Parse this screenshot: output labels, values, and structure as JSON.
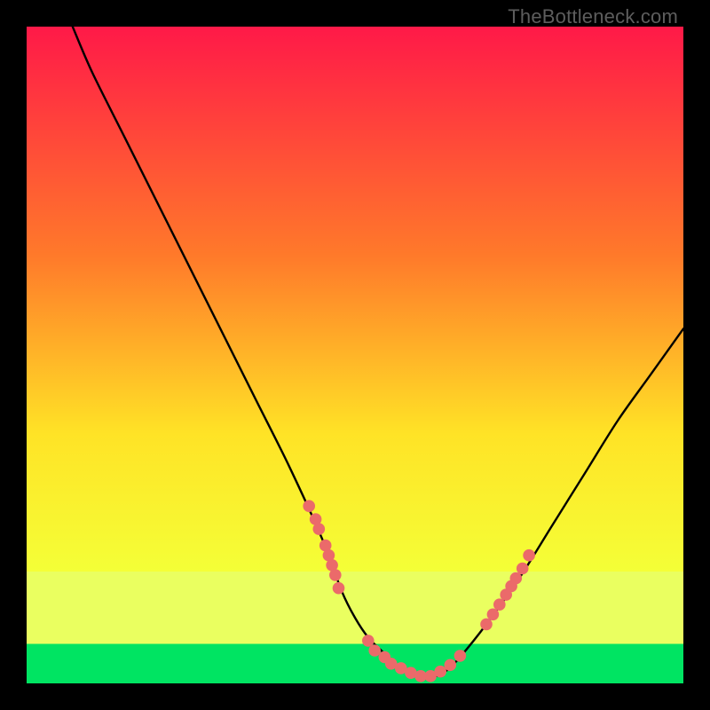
{
  "watermark": "TheBottleneck.com",
  "colors": {
    "gradient_top": "#ff1948",
    "gradient_mid1": "#ff7a2a",
    "gradient_mid2": "#ffe326",
    "gradient_low": "#f4ff37",
    "gradient_bottom_band_top": "#eaff60",
    "gradient_bottom_band_bottom": "#00e462",
    "curve": "#000000",
    "dots": "#eb6a6a",
    "frame_bg": "#000000"
  },
  "chart_data": {
    "type": "line",
    "title": "",
    "xlabel": "",
    "ylabel": "",
    "xlim": [
      0,
      100
    ],
    "ylim": [
      0,
      100
    ],
    "series": [
      {
        "name": "bottleneck-curve",
        "x": [
          7,
          10,
          15,
          20,
          25,
          30,
          35,
          40,
          45,
          48,
          50,
          52,
          54,
          56,
          58,
          60,
          62,
          64,
          66,
          70,
          75,
          80,
          85,
          90,
          95,
          100
        ],
        "y": [
          100,
          93,
          83,
          73,
          63,
          53,
          43,
          33,
          22,
          14,
          10,
          7,
          5,
          3,
          2,
          1,
          1,
          2,
          4,
          9,
          16,
          24,
          32,
          40,
          47,
          54
        ]
      }
    ],
    "dot_clusters": [
      {
        "name": "left-cluster",
        "points": [
          [
            43,
            27
          ],
          [
            44,
            25
          ],
          [
            44.5,
            23.5
          ],
          [
            45.5,
            21
          ],
          [
            46,
            19.5
          ],
          [
            46.5,
            18
          ],
          [
            47,
            16.5
          ],
          [
            47.5,
            14.5
          ]
        ]
      },
      {
        "name": "valley-cluster",
        "points": [
          [
            52,
            6.5
          ],
          [
            53,
            5
          ],
          [
            54.5,
            4
          ],
          [
            55.5,
            3
          ],
          [
            57,
            2.3
          ],
          [
            58.5,
            1.6
          ],
          [
            60,
            1.1
          ],
          [
            61.5,
            1.1
          ],
          [
            63,
            1.8
          ],
          [
            64.5,
            2.8
          ],
          [
            66,
            4.2
          ]
        ]
      },
      {
        "name": "right-cluster",
        "points": [
          [
            70,
            9
          ],
          [
            71,
            10.5
          ],
          [
            72,
            12
          ],
          [
            73,
            13.5
          ],
          [
            73.8,
            14.8
          ],
          [
            74.5,
            16
          ],
          [
            75.5,
            17.5
          ],
          [
            76.5,
            19.5
          ]
        ]
      }
    ],
    "green_band": {
      "from_y": 0,
      "to_y": 6
    },
    "yellow_band": {
      "from_y": 6,
      "to_y": 17
    }
  }
}
